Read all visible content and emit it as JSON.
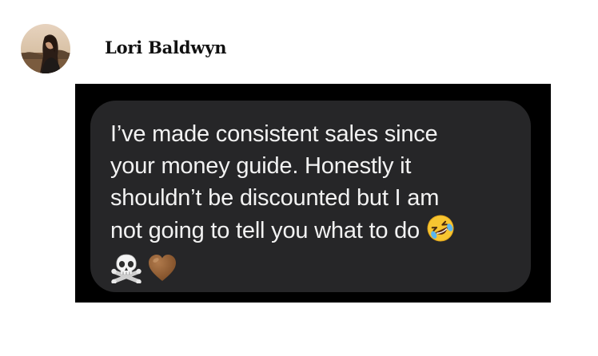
{
  "author": {
    "name": "Lori Baldwyn",
    "avatar_icon": "profile-photo"
  },
  "message": {
    "lines": [
      "I’ve made consistent sales since",
      "your money guide. Honestly it",
      "shouldn’t be discounted but I am",
      "not going to tell you what to do"
    ],
    "emojis": [
      "rolling-on-floor-laughing-emoji",
      "skull-and-crossbones-emoji",
      "brown-heart-emoji"
    ],
    "bubble_color": "#262628",
    "text_color": "#f2f2f2",
    "background_color": "#000000"
  }
}
